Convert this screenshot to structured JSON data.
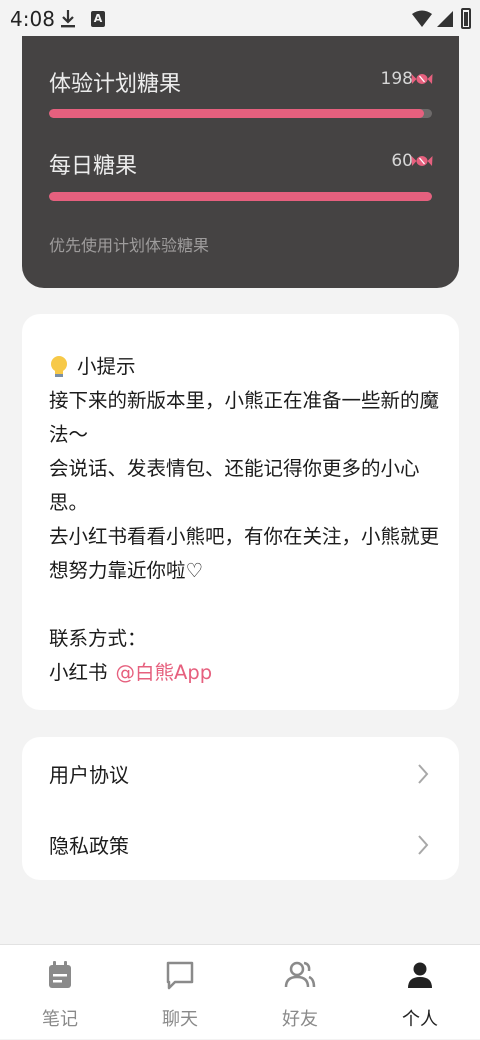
{
  "status_bar": {
    "time": "4:08"
  },
  "candy": {
    "plan_label": "体验计划糖果",
    "plan_count": "198",
    "plan_fill": 0.98,
    "daily_label": "每日糖果",
    "daily_count": "60",
    "daily_fill": 1.0,
    "note": "优先使用计划体验糖果",
    "accent_color": "#e6607e"
  },
  "tip": {
    "title": "小提示",
    "lines": [
      "接下来的新版本里，小熊正在准备一些新的魔",
      "法～",
      "会说话、发表情包、还能记得你更多的小心",
      "思。",
      "去小红书看看小熊吧，有你在关注，小熊就更",
      "想努力靠近你啦♡"
    ],
    "contact_label": "联系方式：",
    "contact_platform": "小红书",
    "contact_handle": "@白熊App"
  },
  "links": {
    "user_agreement": "用户协议",
    "privacy_policy": "隐私政策"
  },
  "nav": {
    "items": [
      {
        "label": "笔记",
        "icon": "calendar-note-icon"
      },
      {
        "label": "聊天",
        "icon": "chat-bubble-icon"
      },
      {
        "label": "好友",
        "icon": "friends-icon"
      },
      {
        "label": "个人",
        "icon": "person-icon"
      }
    ],
    "active_index": 3
  }
}
